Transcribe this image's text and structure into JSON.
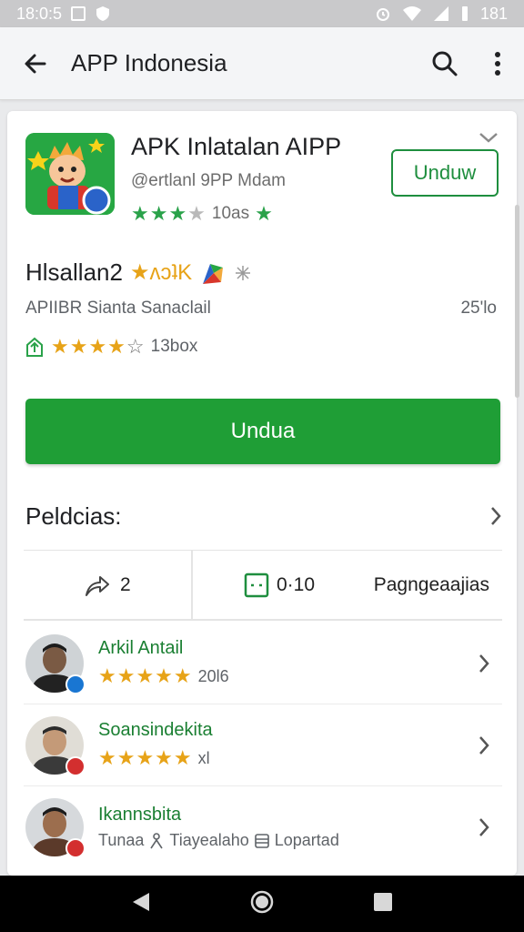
{
  "status_bar": {
    "time": "18:0:5",
    "right_text": "181"
  },
  "app_bar": {
    "title": "APP Indonesia"
  },
  "app_header": {
    "name": "APK Inlatalan AIPP",
    "developer": "@ertlanl 9PP Mdam",
    "rating_text": "10as",
    "install_label": "Unduw"
  },
  "section": {
    "title": "Hlsallan2",
    "title_badge": "★ʌɔʇK",
    "subtitle": "APIIBR Sianta Sanaclail",
    "size": "25'lo",
    "rating_text": "13box"
  },
  "download": {
    "label": "Undua"
  },
  "details": {
    "label": "Peldcias:"
  },
  "stats": {
    "share_count": "2",
    "count": "0·10",
    "label": "Pagngeaajias"
  },
  "people": [
    {
      "name": "Arkil Antail",
      "meta": "20l6",
      "badge_color": "#1976d2",
      "skin": "#7a5a44",
      "shirt": "#222"
    },
    {
      "name": "Soansindekita",
      "meta": "хl",
      "badge_color": "#d32f2f",
      "skin": "#c49a78",
      "shirt": "#3a3a3a"
    },
    {
      "name": "Ikannsbita",
      "meta_a": "Tunaa",
      "meta_b": "Tiayealaho",
      "meta_c": "Lopartad",
      "badge_color": "#d32f2f",
      "skin": "#9c6e4e",
      "shirt": "#5b3a2a"
    }
  ],
  "colors": {
    "accent_green": "#1f9e36",
    "star_gold": "#e7a318",
    "star_green": "#2aa24a"
  }
}
